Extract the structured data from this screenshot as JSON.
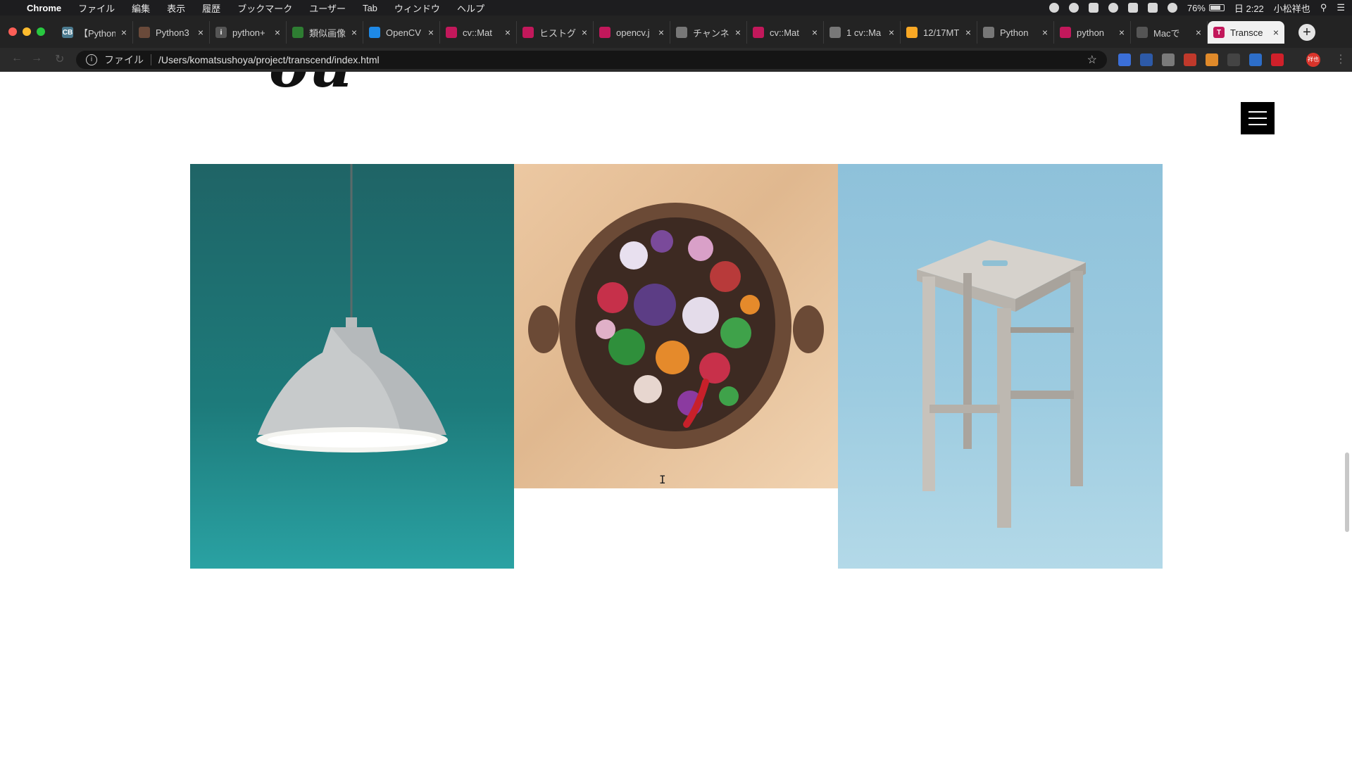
{
  "menubar": {
    "apple_glyph": "",
    "items": [
      "Chrome",
      "ファイル",
      "編集",
      "表示",
      "履歴",
      "ブックマーク",
      "ユーザー",
      "Tab",
      "ウィンドウ",
      "ヘルプ"
    ],
    "battery": "76%",
    "battery_level": 0.76,
    "day_time": "日 2:22",
    "user": "小松祥也"
  },
  "tabs": [
    {
      "title": "【Python",
      "fav": "CB",
      "color": "#4b7a8f"
    },
    {
      "title": "Python3",
      "fav": "",
      "color": "#6a4a3a"
    },
    {
      "title": "python+",
      "fav": "i",
      "color": "#555555"
    },
    {
      "title": "類似画像",
      "fav": "",
      "color": "#2e7d32"
    },
    {
      "title": "OpenCV",
      "fav": "",
      "color": "#1e88e5"
    },
    {
      "title": "cv::Mat",
      "fav": "",
      "color": "#c2185b"
    },
    {
      "title": "ヒストグ",
      "fav": "",
      "color": "#c2185b"
    },
    {
      "title": "opencv.j",
      "fav": "",
      "color": "#c2185b"
    },
    {
      "title": "チャンネ",
      "fav": "",
      "color": "#777777"
    },
    {
      "title": "cv::Mat",
      "fav": "",
      "color": "#c2185b"
    },
    {
      "title": "1 cv::Ma",
      "fav": "",
      "color": "#777777"
    },
    {
      "title": "12/17MT",
      "fav": "",
      "color": "#f9a825"
    },
    {
      "title": "Python",
      "fav": "",
      "color": "#777777"
    },
    {
      "title": "python",
      "fav": "",
      "color": "#c2185b"
    },
    {
      "title": "Macで",
      "fav": "",
      "color": "#555555"
    },
    {
      "title": "Transce",
      "fav": "T",
      "color": "#c2185b",
      "active": true
    }
  ],
  "toolbar": {
    "scheme_label": "ファイル",
    "url": "/Users/komatsushoya/project/transcend/index.html",
    "profile_label": "祥也",
    "extension_colors": [
      "#3b6fd8",
      "#2d5aa8",
      "#7a7a7a",
      "#c0392b",
      "#e08a2a",
      "#444444",
      "#2d6ec9",
      "#d0202a"
    ]
  },
  "page": {
    "hero_partial": "ou"
  }
}
